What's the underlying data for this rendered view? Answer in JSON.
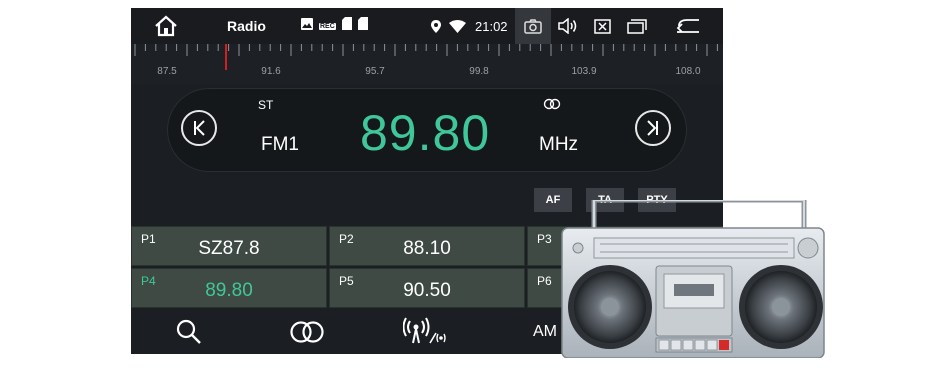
{
  "statusbar": {
    "home_icon": "home-icon",
    "title": "Radio",
    "notification_icons": [
      "image-icon",
      "rec-icon",
      "sd-card-icon",
      "sd-card-icon"
    ],
    "rec_label": "REC",
    "time": "21:02",
    "right_icons": [
      "location-icon",
      "wifi-icon",
      "camera-icon",
      "volume-icon",
      "close-box-icon",
      "window-icon",
      "back-icon"
    ]
  },
  "tuner": {
    "scale_labels": [
      "87.5",
      "91.6",
      "95.7",
      "99.8",
      "103.9",
      "108.0"
    ],
    "needle_color": "#d21f1f"
  },
  "main": {
    "stereo_indicator": "ST",
    "band": "FM1",
    "frequency": "89.80",
    "unit": "MHz",
    "accent": "#3fc79a"
  },
  "buttons": {
    "af": "AF",
    "ta": "TA",
    "pty": "PTY"
  },
  "presets": [
    {
      "num": "P1",
      "freq": "SZ87.8",
      "active": false
    },
    {
      "num": "P2",
      "freq": "88.10",
      "active": false
    },
    {
      "num": "P3",
      "freq": "",
      "active": false
    },
    {
      "num": "P4",
      "freq": "89.80",
      "active": true
    },
    {
      "num": "P5",
      "freq": "90.50",
      "active": false
    },
    {
      "num": "P6",
      "freq": "",
      "active": false
    }
  ],
  "bottombar": {
    "icons": [
      "search-icon",
      "stereo-icon",
      "antenna-icon"
    ],
    "am_label": "AM"
  },
  "decoration": {
    "image": "boombox-illustration"
  }
}
